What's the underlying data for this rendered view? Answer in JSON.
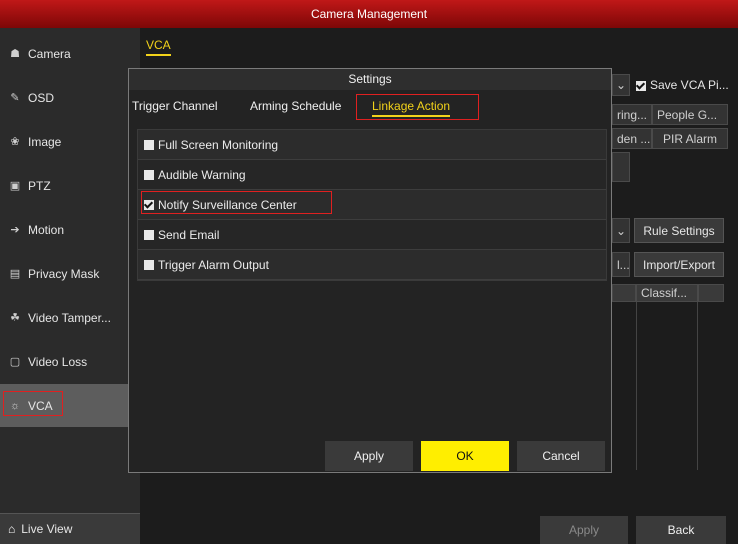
{
  "window": {
    "title": "Camera Management"
  },
  "sidebar": {
    "items": [
      {
        "label": "Camera",
        "icon": "camera-icon",
        "glyph": "☗"
      },
      {
        "label": "OSD",
        "icon": "osd-icon",
        "glyph": "✎"
      },
      {
        "label": "Image",
        "icon": "image-icon",
        "glyph": "❀"
      },
      {
        "label": "PTZ",
        "icon": "ptz-icon",
        "glyph": "▣"
      },
      {
        "label": "Motion",
        "icon": "motion-icon",
        "glyph": "➔"
      },
      {
        "label": "Privacy Mask",
        "icon": "privacy-mask-icon",
        "glyph": "▤"
      },
      {
        "label": "Video Tamper...",
        "icon": "video-tamper-icon",
        "glyph": "☘"
      },
      {
        "label": "Video Loss",
        "icon": "video-loss-icon",
        "glyph": "▢"
      },
      {
        "label": "VCA",
        "icon": "vca-icon",
        "glyph": "☼"
      }
    ],
    "live_view": {
      "label": "Live View",
      "icon": "home-icon",
      "glyph": "⌂"
    }
  },
  "main": {
    "tab": "VCA",
    "save_vca_label": "Save VCA Pi...",
    "bg_tabs_row1": [
      "ring...",
      "People G..."
    ],
    "bg_tabs_row2": [
      "den ...",
      "PIR Alarm"
    ],
    "rule_settings_label": "Rule Settings",
    "truncated_label": "l...",
    "import_export_label": "Import/Export",
    "classif_header": "Classif...",
    "apply_label": "Apply",
    "back_label": "Back"
  },
  "dialog": {
    "title": "Settings",
    "tabs": [
      "Trigger Channel",
      "Arming Schedule",
      "Linkage Action"
    ],
    "active_tab": "Linkage Action",
    "options": [
      {
        "label": "Full Screen Monitoring",
        "checked": false
      },
      {
        "label": "Audible Warning",
        "checked": false
      },
      {
        "label": "Notify Surveillance Center",
        "checked": true
      },
      {
        "label": "Send Email",
        "checked": false
      },
      {
        "label": "Trigger Alarm Output",
        "checked": false
      }
    ],
    "buttons": {
      "apply": "Apply",
      "ok": "OK",
      "cancel": "Cancel"
    }
  },
  "colors": {
    "title_red": "#b01414",
    "accent_yellow": "#f2d21a",
    "highlight_red": "#e02020",
    "ok_yellow": "#ffee00"
  }
}
